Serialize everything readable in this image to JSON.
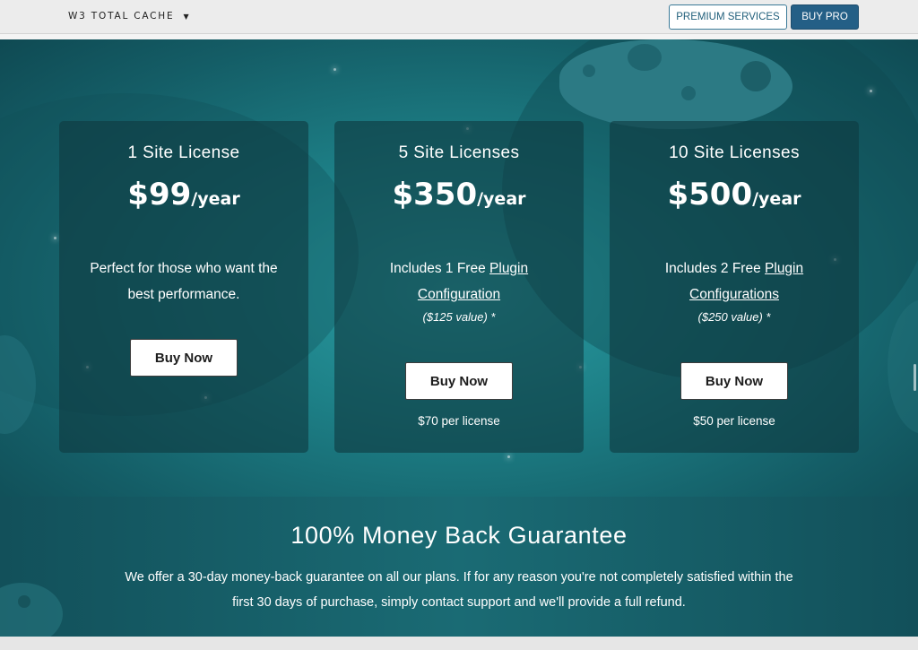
{
  "header": {
    "brand": "W3 TOTAL CACHE",
    "brand_caret": "▼",
    "premium_label": "PREMIUM SERVICES",
    "buypro_label": "BUY PRO"
  },
  "colors": {
    "accent": "#245f86",
    "card_bg": "#0e3a40",
    "hero_bg": "#1d7f86"
  },
  "plans": [
    {
      "title": "1 Site License",
      "price": "$99",
      "period": "/year",
      "desc_line1": "Perfect for those who want the",
      "desc_line2": "best performance.",
      "button": "Buy Now"
    },
    {
      "title": "5 Site Licenses",
      "price": "$350",
      "period": "/year",
      "desc_prefix": "Includes 1 Free ",
      "desc_link1": "Plugin",
      "desc_link2": "Configuration",
      "note": "($125 value) *",
      "button": "Buy Now",
      "per_license": "$70 per license"
    },
    {
      "title": "10 Site Licenses",
      "price": "$500",
      "period": "/year",
      "desc_prefix": "Includes 2 Free ",
      "desc_link1": "Plugin",
      "desc_link2": "Configurations",
      "note": "($250 value) *",
      "button": "Buy Now",
      "per_license": "$50 per license"
    }
  ],
  "guarantee": {
    "title": "100% Money Back Guarantee",
    "line1": "We offer a 30-day money-back guarantee on all our plans. If for any reason you're not completely satisfied within the",
    "line2": "first 30 days of purchase, simply contact support and we'll provide a full refund."
  }
}
